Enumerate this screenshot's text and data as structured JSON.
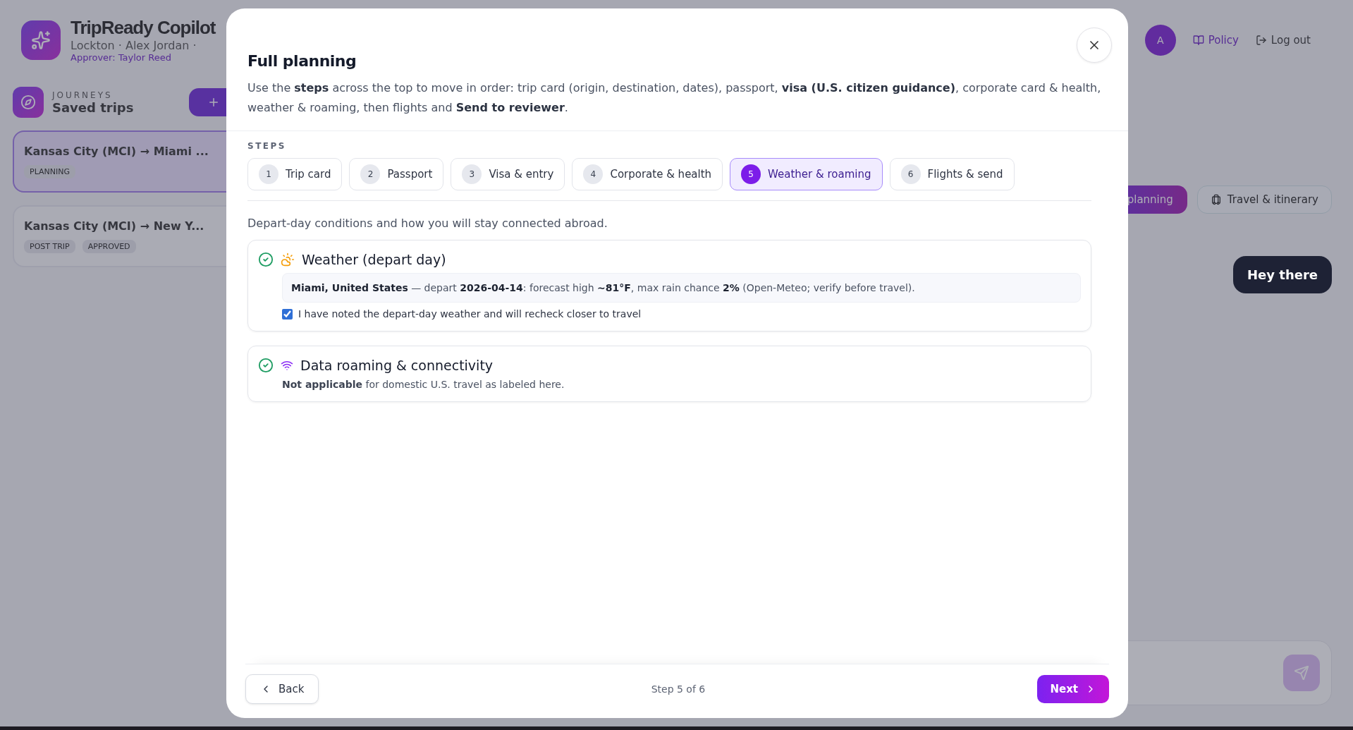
{
  "background": {
    "app_title": "TripReady Copilot",
    "org_line": "Lockton · Alex Jordan ·",
    "approver": "Approver: Taylor Reed",
    "avatar": "A",
    "nav": [
      {
        "label": "Policy",
        "kind": "policy"
      },
      {
        "label": "Log out",
        "kind": "logout"
      }
    ],
    "journeys_label": "JOURNEYS",
    "journeys_title": "Saved trips",
    "trips": [
      {
        "title": "Kansas City (MCI) → Miami ...",
        "selected": true,
        "tags": [
          "PLANNING"
        ]
      },
      {
        "title": "Kansas City (MCI) → New Y...",
        "selected": false,
        "tags": [
          "POST TRIP",
          "APPROVED"
        ]
      }
    ],
    "mode_button": "planning",
    "travel_tab": "Travel & itinerary",
    "chat_bubble": "Hey there"
  },
  "modal": {
    "title": "Full planning",
    "intro": "Use the **steps** across the top to move in order: trip card (origin, destination, dates), passport, **visa (U.S. citizen guidance)**, corporate card & health, weather & roaming, then flights and **Send to reviewer**.",
    "steps_label": "STEPS",
    "steps": [
      {
        "number": "1",
        "label": "Trip card",
        "selected": false
      },
      {
        "number": "2",
        "label": "Passport",
        "selected": false
      },
      {
        "number": "3",
        "label": "Visa & entry",
        "selected": false
      },
      {
        "number": "4",
        "label": "Corporate & health",
        "selected": false
      },
      {
        "number": "5",
        "label": "Weather & roaming",
        "selected": true
      },
      {
        "number": "6",
        "label": "Flights & send",
        "selected": false
      }
    ],
    "section_intro": "Depart-day conditions and how you will stay connected abroad.",
    "cards": [
      {
        "kind": "weather",
        "title": "Weather (depart day)",
        "complete": true,
        "summary": "**Miami, United States** — depart **2026-04-14**: forecast high **~81°F**, max rain chance **2%** (Open-Meteo; verify before travel).",
        "checkbox": {
          "label": "I have noted the depart-day weather and will recheck closer to travel",
          "checked": true
        }
      },
      {
        "kind": "roaming",
        "title": "Data roaming & connectivity",
        "complete": true,
        "note": "**Not applicable** for domestic U.S. travel as labeled here."
      }
    ],
    "footer": {
      "back": "Back",
      "step_text": "Step 5 of 6",
      "next": "Next"
    }
  }
}
